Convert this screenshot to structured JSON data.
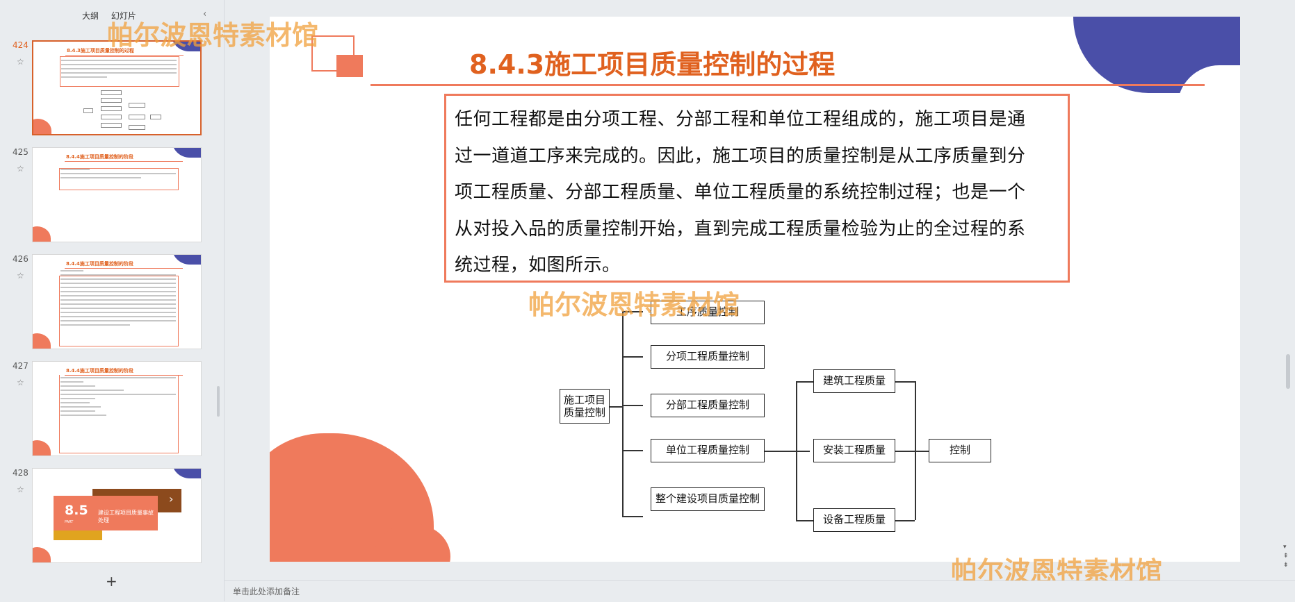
{
  "sidebar": {
    "tabs": [
      "大纲",
      "幻灯片"
    ],
    "collapse_icon": "chevron-left-icon",
    "thumbnails": [
      {
        "number": "424",
        "title": "8.4.3施工项目质量控制的过程",
        "selected": true
      },
      {
        "number": "425",
        "title": "8.4.4施工项目质量控制的阶段",
        "sub": "1.事前质量控制"
      },
      {
        "number": "426",
        "title": "8.4.4施工项目质量控制的阶段",
        "sub": "2.事中质量控制"
      },
      {
        "number": "427",
        "title": "8.4.4施工项目质量控制的阶段"
      },
      {
        "number": "428",
        "cover_number": "8.5",
        "cover_part": "PART",
        "cover_text": "建设工程项目质量事故处理"
      }
    ],
    "add_slide_label": "+"
  },
  "slide": {
    "title": "8.4.3施工项目质量控制的过程",
    "paragraph": "任何工程都是由分项工程、分部工程和单位工程组成的，施工项目是通过一道道工序来完成的。因此，施工项目的质量控制是从工序质量到分项工程质量、分部工程质量、单位工程质量的系统控制过程；也是一个从对投入品的质量控制开始，直到完成工程质量检验为止的全过程的系统过程，如图所示。",
    "paragraph_lines": [
      "任何工程都是由分项工程、分部工程和单位工程组成的，施工项目是通",
      "过一道道工序来完成的。因此，施工项目的质量控制是从工序质量到分",
      "项工程质量、分部工程质量、单位工程质量的系统控制过程；也是一个",
      "从对投入品的质量控制开始，直到完成工程质量检验为止的全过程的系",
      "统过程，如图所示。"
    ],
    "diagram": {
      "root": [
        "施工项目",
        "质量控制"
      ],
      "level1": [
        "工序质量控制",
        "分项工程质量控制",
        "分部工程质量控制",
        "单位工程质量控制",
        "整个建设项目质量控制"
      ],
      "level2": [
        "建筑工程质量",
        "安装工程质量",
        "设备工程质量"
      ],
      "level3": "控制"
    }
  },
  "watermark": "帕尔波恩特素材馆",
  "notes_placeholder": "单击此处添加备注",
  "colors": {
    "accent_orange": "#e0611f",
    "deco_orange": "#ef7a5c",
    "deco_blue": "#4a4fa8"
  }
}
